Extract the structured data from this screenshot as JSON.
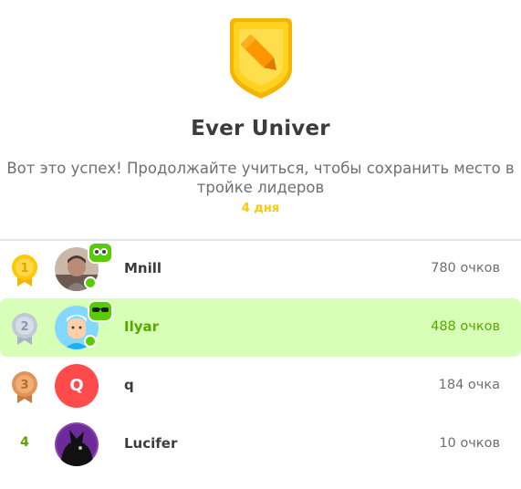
{
  "league": {
    "title": "Ever Univer",
    "subtitle": "Вот это успех! Продолжайте учиться, чтобы сохранить место в тройке лидеров",
    "time_left": "4 дня",
    "badge_icon": "pencil-league-badge-icon"
  },
  "colors": {
    "accent_green": "#58a700",
    "highlight_row": "#d7ffb8",
    "gold": "#ffc800",
    "divider": "#e5e5e5"
  },
  "leaderboard": [
    {
      "rank": "1",
      "name": "Mnill",
      "points": "780 очков",
      "avatar": "photo",
      "medal": "gold",
      "online": true
    },
    {
      "rank": "2",
      "name": "Ilyar",
      "points": "488 очков",
      "avatar": "cartoon",
      "medal": "silver",
      "online": true,
      "current_user": true
    },
    {
      "rank": "3",
      "name": "q",
      "points": "184 очка",
      "avatar_letter": "Q",
      "medal": "bronze"
    },
    {
      "rank": "4",
      "name": "Lucifer",
      "points": "10 очков",
      "avatar": "silhouette"
    }
  ]
}
